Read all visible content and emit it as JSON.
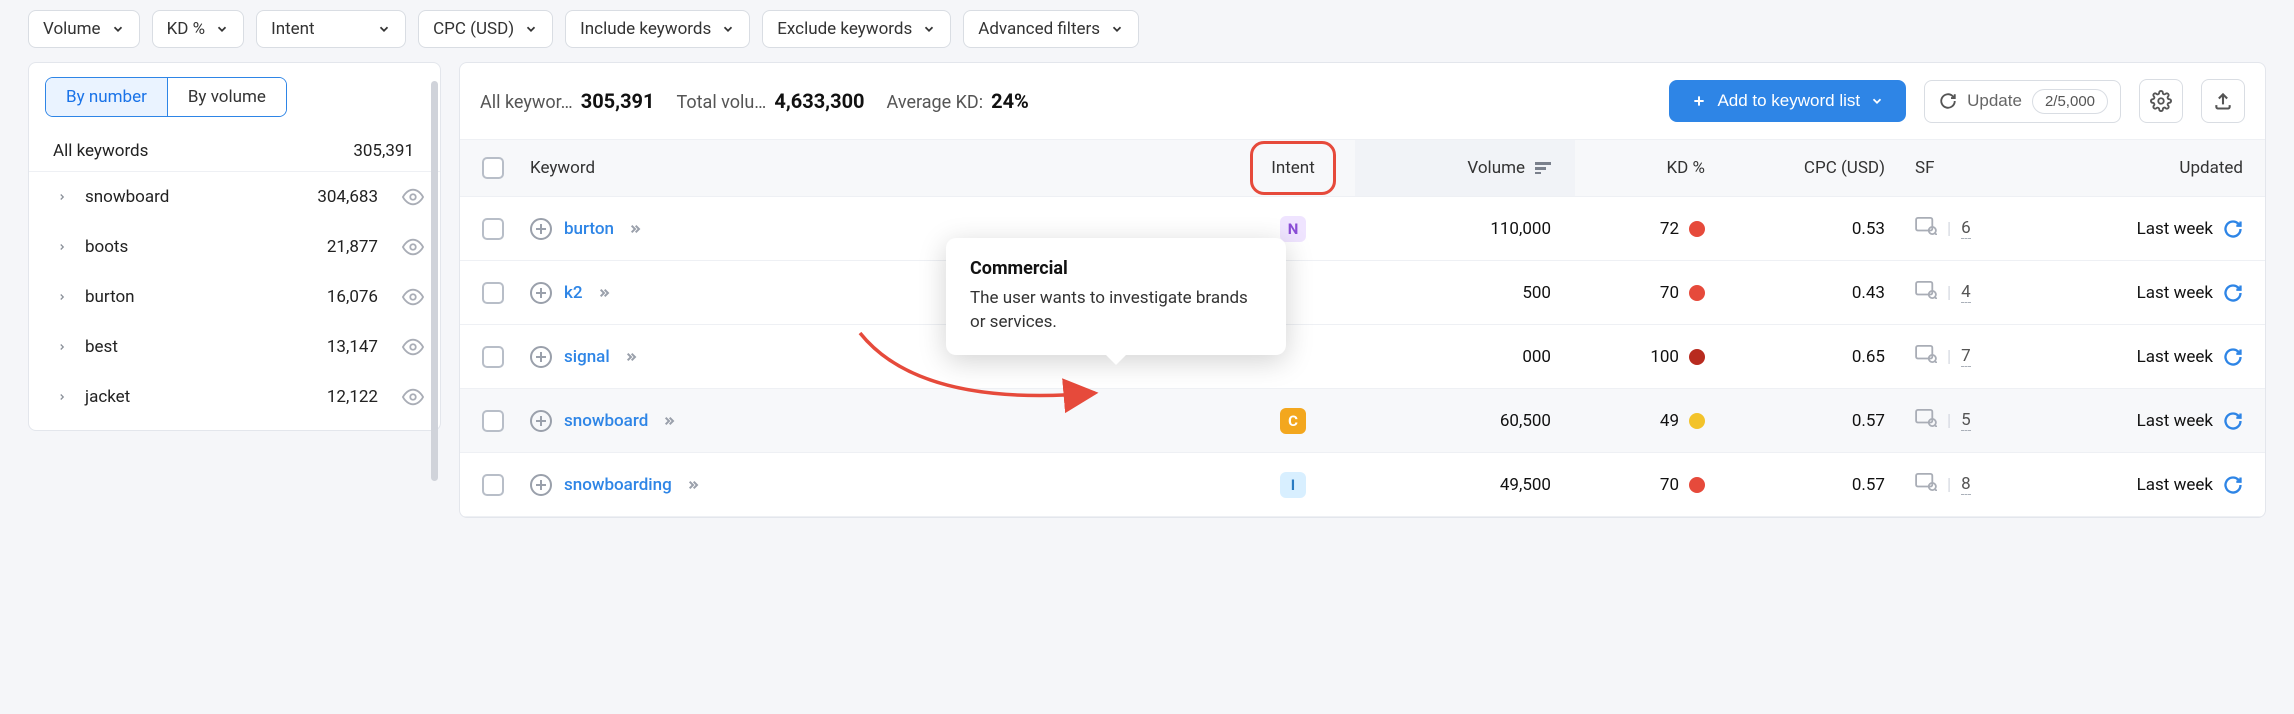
{
  "filters": [
    {
      "label": "Volume"
    },
    {
      "label": "KD %"
    },
    {
      "label": "Intent"
    },
    {
      "label": "CPC (USD)"
    },
    {
      "label": "Include keywords"
    },
    {
      "label": "Exclude keywords"
    },
    {
      "label": "Advanced filters"
    }
  ],
  "sidebar": {
    "seg": {
      "by_number": "By number",
      "by_volume": "By volume"
    },
    "header_label": "All keywords",
    "header_count": "305,391",
    "items": [
      {
        "label": "snowboard",
        "count": "304,683"
      },
      {
        "label": "boots",
        "count": "21,877"
      },
      {
        "label": "burton",
        "count": "16,076"
      },
      {
        "label": "best",
        "count": "13,147"
      },
      {
        "label": "jacket",
        "count": "12,122"
      }
    ]
  },
  "summary": {
    "all_label": "All keywor…",
    "all_value": "305,391",
    "tv_label": "Total volu…",
    "tv_value": "4,633,300",
    "avg_label": "Average KD:",
    "avg_value": "24%"
  },
  "actions": {
    "add_list": "Add to keyword list",
    "update": "Update",
    "update_count": "2/5,000"
  },
  "columns": {
    "keyword": "Keyword",
    "intent": "Intent",
    "volume": "Volume",
    "kd": "KD %",
    "cpc": "CPC (USD)",
    "sf": "SF",
    "updated": "Updated"
  },
  "rows": [
    {
      "keyword": "burton",
      "intent": "N",
      "volume": "110,000",
      "kd": "72",
      "kd_dot": "red",
      "cpc": "0.53",
      "sf": "6",
      "updated": "Last week"
    },
    {
      "keyword": "k2",
      "intent": "",
      "volume": "500",
      "kd": "70",
      "kd_dot": "red",
      "cpc": "0.43",
      "sf": "4",
      "updated": "Last week"
    },
    {
      "keyword": "signal",
      "intent": "",
      "volume": "000",
      "kd": "100",
      "kd_dot": "darkred",
      "cpc": "0.65",
      "sf": "7",
      "updated": "Last week"
    },
    {
      "keyword": "snowboard",
      "intent": "C",
      "volume": "60,500",
      "kd": "49",
      "kd_dot": "yellow",
      "cpc": "0.57",
      "sf": "5",
      "updated": "Last week"
    },
    {
      "keyword": "snowboarding",
      "intent": "I",
      "volume": "49,500",
      "kd": "70",
      "kd_dot": "red",
      "cpc": "0.57",
      "sf": "8",
      "updated": "Last week"
    }
  ],
  "tooltip": {
    "title": "Commercial",
    "body": "The user wants to investigate brands or services."
  }
}
